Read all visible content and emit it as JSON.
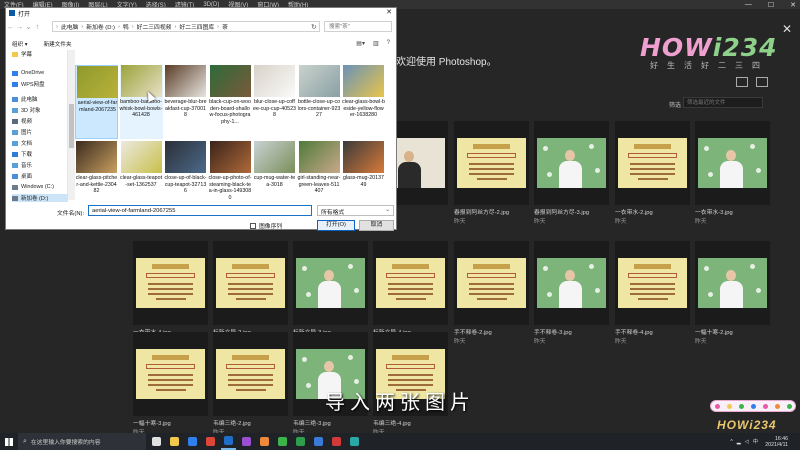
{
  "ps": {
    "menu": [
      "文件(F)",
      "编辑(E)",
      "图像(I)",
      "图层(L)",
      "文字(Y)",
      "选择(S)",
      "滤镜(T)",
      "3D(D)",
      "视图(V)",
      "窗口(W)",
      "帮助(H)"
    ],
    "welcome": "欢迎使用 Photoshop。",
    "filter_label": "筛选",
    "filter_placeholder": "筛选最近的文件",
    "thumbnails": [
      {
        "name": ".psd",
        "date": "",
        "kind": "intro"
      },
      {
        "name": "春报到阿丝方尽-2.jpg",
        "date": "昨天",
        "kind": "doc"
      },
      {
        "name": "春报到阿丝方尽-3.jpg",
        "date": "昨天",
        "kind": "person"
      },
      {
        "name": "一衣带水-2.jpg",
        "date": "昨天",
        "kind": "doc"
      },
      {
        "name": "一衣带水-3.jpg",
        "date": "昨天",
        "kind": "person"
      },
      {
        "name": "一衣带水-4.jpg",
        "date": "昨天",
        "kind": "doc"
      },
      {
        "name": "标新立异-2.jpg",
        "date": "昨天",
        "kind": "doc"
      },
      {
        "name": "标新立异-3.jpg",
        "date": "昨天",
        "kind": "person"
      },
      {
        "name": "标新立异-4.jpg",
        "date": "昨天",
        "kind": "doc"
      },
      {
        "name": "手不释卷-2.jpg",
        "date": "昨天",
        "kind": "doc"
      },
      {
        "name": "手不释卷-3.jpg",
        "date": "昨天",
        "kind": "person"
      },
      {
        "name": "手不释卷-4.jpg",
        "date": "昨天",
        "kind": "doc"
      },
      {
        "name": "一幅十寒-2.jpg",
        "date": "昨天",
        "kind": "person"
      },
      {
        "name": "一幅十寒-3.jpg",
        "date": "昨天",
        "kind": "doc"
      },
      {
        "name": "韦编三绝-2.jpg",
        "date": "昨天",
        "kind": "doc"
      },
      {
        "name": "韦编三绝-3.jpg",
        "date": "昨天",
        "kind": "person"
      },
      {
        "name": "韦编三绝-4.jpg",
        "date": "昨天",
        "kind": "doc"
      }
    ]
  },
  "logo": {
    "main_a": "HOW",
    "main_b": "i234",
    "sub": "好生活好二三四"
  },
  "dialog": {
    "title": "打开",
    "path": [
      "此电脑",
      "新加卷 (D:)",
      "鸭",
      "好二三四视频",
      "好二三四图库",
      "茶"
    ],
    "search_placeholder": "搜索\"茶\"",
    "organize": "组织 ▾",
    "new_folder": "新建文件夹",
    "nav": [
      {
        "label": "学幕",
        "color": "#f2c94c"
      },
      {
        "label": "OneDrive",
        "color": "#2f80ed"
      },
      {
        "label": "WPS网盘",
        "color": "#2f80ed"
      },
      {
        "label": "此电脑",
        "color": "#4a90d9"
      },
      {
        "label": "3D 对象",
        "color": "#5aa0d8"
      },
      {
        "label": "视频",
        "color": "#5b6b7c"
      },
      {
        "label": "图片",
        "color": "#5aa0d8"
      },
      {
        "label": "文档",
        "color": "#5aa0d8"
      },
      {
        "label": "下载",
        "color": "#2d7dd2"
      },
      {
        "label": "音乐",
        "color": "#5aa0d8"
      },
      {
        "label": "桌面",
        "color": "#4a90d9"
      },
      {
        "label": "Windows (C:)",
        "color": "#6b7b8c"
      },
      {
        "label": "新加卷 (D:)",
        "color": "#6b7b8c"
      }
    ],
    "files": [
      {
        "label": "aerial-view-of-farmland-2067235",
        "state": "sel",
        "c1": "#8e9a2c",
        "c2": "#b9b23a"
      },
      {
        "label": "bamboo-bamboo-whisk-bowl-bowls-461428",
        "state": "hov",
        "c1": "#9aa33a",
        "c2": "#e9e0c8"
      },
      {
        "label": "beverage-blur-breakfast-cup-370018",
        "state": "",
        "c1": "#5a3b26",
        "c2": "#e8e6e0"
      },
      {
        "label": "black-cup-on-wooden-board-shallow-focus-photography-1...",
        "state": "",
        "c1": "#2e6b3a",
        "c2": "#7a5a3a"
      },
      {
        "label": "blur-close-up-coffee-cup-cup-405238",
        "state": "",
        "c1": "#d8d2c8",
        "c2": "#fafafa"
      },
      {
        "label": "bottle-close-up-colors-container-92327",
        "state": "",
        "c1": "#c9d2cc",
        "c2": "#8aa0a6"
      },
      {
        "label": "clear-glass-bowl-beside-yellow-flower-1638280",
        "state": "",
        "c1": "#6a92b8",
        "c2": "#e8c44a"
      },
      {
        "label": "clear-glass-pitcher-and-kettle-230482",
        "state": "",
        "c1": "#3a2a1e",
        "c2": "#c9a060"
      },
      {
        "label": "clear-glass-teapot-set-1362537",
        "state": "",
        "c1": "#ece9e2",
        "c2": "#c8c04a"
      },
      {
        "label": "close-up-of-black-cup-teapot-327136",
        "state": "",
        "c1": "#2b2f38",
        "c2": "#4c6a8a"
      },
      {
        "label": "close-up-photo-of-steaming-black-tea-in-glass-1493080",
        "state": "",
        "c1": "#3a241a",
        "c2": "#b06a3a"
      },
      {
        "label": "cup-mug-water-tea-3018",
        "state": "",
        "c1": "#c9d2d4",
        "c2": "#7a8f5a"
      },
      {
        "label": "girl-standing-near-green-leaves-511407",
        "state": "",
        "c1": "#4f7a3a",
        "c2": "#c9a88a"
      },
      {
        "label": "glass-mug-2013749",
        "state": "",
        "c1": "#3a3a3a",
        "c2": "#d87a3a"
      }
    ],
    "filename_label": "文件名(N):",
    "filename_value": "aerial-view-of-farmland-2067255",
    "filetype": "所有格式",
    "sequence": "图像序列",
    "open": "打开(O)",
    "cancel": "取消"
  },
  "subtitle": "导入两张图片",
  "taskbar": {
    "search_placeholder": "在这里输入你要搜索的内容",
    "apps": [
      {
        "name": "task-view",
        "color": "#e0e0e0"
      },
      {
        "name": "explorer",
        "color": "#f2c94c"
      },
      {
        "name": "mail",
        "color": "#2f80ed"
      },
      {
        "name": "chrome",
        "color": "#e0453a"
      },
      {
        "name": "photoshop",
        "color": "#1f6fc8"
      },
      {
        "name": "premiere",
        "color": "#9b4fd0"
      },
      {
        "name": "app-orange",
        "color": "#f08a3a"
      },
      {
        "name": "wechat",
        "color": "#3bb54a"
      },
      {
        "name": "app-green",
        "color": "#2e9e4a"
      },
      {
        "name": "app-blue",
        "color": "#3a7ad8"
      },
      {
        "name": "app-red",
        "color": "#d23a3a"
      },
      {
        "name": "app-teal",
        "color": "#2aa8a8"
      }
    ],
    "time": "16:46",
    "date": "2021/4/11",
    "lang": "中"
  }
}
